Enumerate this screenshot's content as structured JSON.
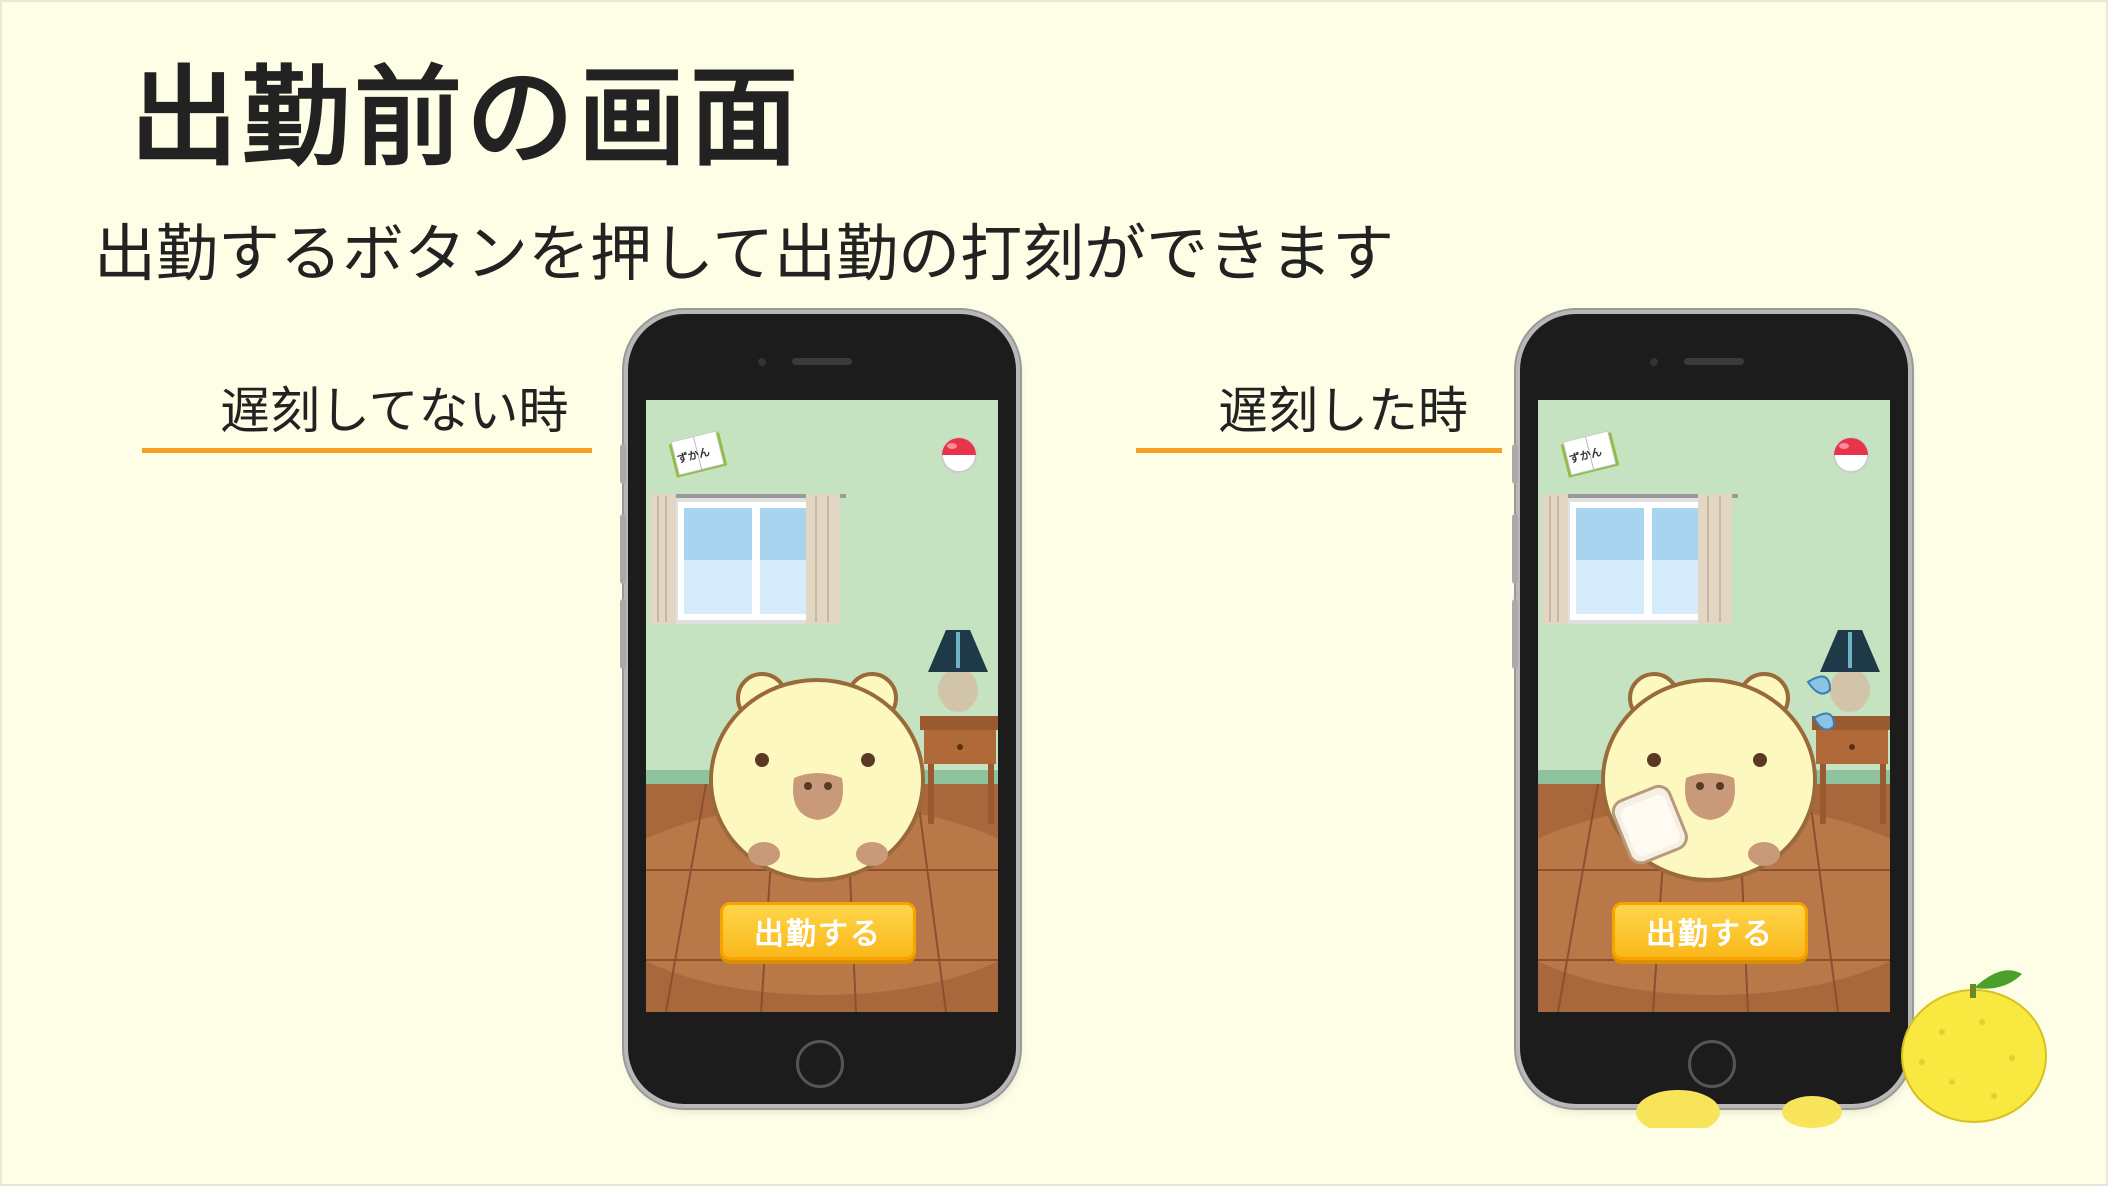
{
  "slide": {
    "title": "出勤前の画面",
    "subtitle": "出勤するボタンを押して出勤の打刻ができます"
  },
  "cases": [
    {
      "label": "遅刻してない時",
      "screen": {
        "book_label": "ずかん",
        "button_label": "出勤する",
        "character_state": "normal"
      }
    },
    {
      "label": "遅刻した時",
      "screen": {
        "book_label": "ずかん",
        "button_label": "出勤する",
        "character_state": "late-with-toast-and-sweat"
      }
    }
  ],
  "colors": {
    "background": "#fefee6",
    "accent_underline": "#f5a020",
    "button_fill": "#ffc928",
    "wall": "#c5e3c1",
    "floor": "#a9683c"
  }
}
